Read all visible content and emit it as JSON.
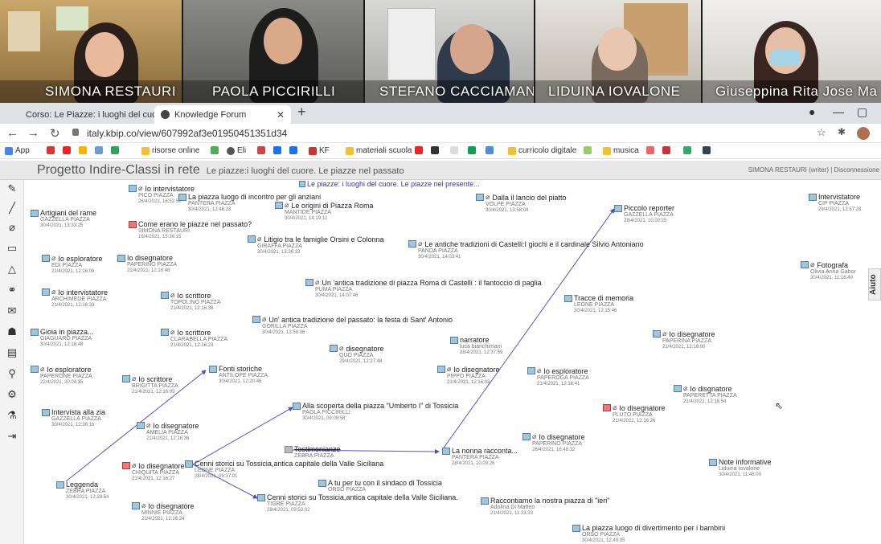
{
  "participants": [
    {
      "name": "SIMONA RESTAURI"
    },
    {
      "name": "PAOLA PICCIRILLI"
    },
    {
      "name": "STEFANO CACCIAMANI"
    },
    {
      "name": "LIDUINA IOVALONE"
    },
    {
      "name": "Giuseppina Rita Jose Ma"
    }
  ],
  "browser": {
    "tabs": [
      {
        "label": "Corso: Le Piazze: i luoghi del cuo"
      },
      {
        "label": "Knowledge Forum"
      }
    ],
    "new_tab": "+",
    "url": "italy.kbip.co/view/607992af3e01950451351d34",
    "bookmarks": [
      "App",
      "risorse online",
      "Eli",
      "KF",
      "materiali scuola",
      "curricolo digitale",
      "musica"
    ]
  },
  "kf": {
    "project": "Progetto Indire-Classi in rete",
    "view": "Le piazze:i luoghi del cuore. Le piazze nel passato",
    "user": "SIMONA RESTAURI (writer) | Disconnessione",
    "help": "Aiuto",
    "link_note": "Le piazze: i luoghi del cuore. Le piazze nel presente..."
  },
  "notes": [
    {
      "title": "Io intervistatore",
      "author": "PICO PIAZZA",
      "date": "26/4/2021, 16:52:50"
    },
    {
      "title": "La piazza luogo di incontro per gli anziani",
      "author": "PANTERA PIAZZA",
      "date": "30/4/2021, 12:46:23"
    },
    {
      "title": "Artigiani del rame",
      "author": "GAZZELLA PIAZZA",
      "date": "30/4/2021, 13:33:25"
    },
    {
      "title": "Le origini di Piazza Roma",
      "author": "MANTIDE PIAZZA",
      "date": "30/4/2021, 14:19:12"
    },
    {
      "title": "Dalla il lancio del piatto",
      "author": "VOLPE PIAZZA",
      "date": "30/4/2021, 13:58:04"
    },
    {
      "title": "Piccolo reporter",
      "author": "GAZZELLA PIAZZA",
      "date": "28/4/2021, 10:00:25"
    },
    {
      "title": "Intervistatore",
      "author": "CIP PIAZZA",
      "date": "29/4/2021, 12:57:23"
    },
    {
      "title": "Come erano le piazze nel passato?",
      "author": "SIMONA RESTAURI",
      "date": "16/4/2021, 15:36:15"
    },
    {
      "title": "Litigio tra le famiglie Orsini e Colonna",
      "author": "GIRAFFA PIAZZA",
      "date": "30/4/2021, 13:36:33"
    },
    {
      "title": "Le antiche tradizioni di Castelli:I giochi e il cardinale Silvio Antoniano",
      "author": "PANDA PIAZZA",
      "date": "30/4/2021, 14:03:41"
    },
    {
      "title": "Io esploratore",
      "author": "EDI PIAZZA",
      "date": "21/4/2021, 12:16:06"
    },
    {
      "title": "Io disegnatore",
      "author": "PAPERINO PIAZZA",
      "date": "21/4/2021, 12:16:48"
    },
    {
      "title": "Fotografa",
      "author": "Olivia Anna Gabor",
      "date": "30/4/2021, 11:16:49"
    },
    {
      "title": "Un 'antica tradizione di piazza Roma di Castelli : il fantoccio di paglia",
      "author": "PUMA PIAZZA",
      "date": "30/4/2021, 14:07:46"
    },
    {
      "title": "Io intervistatore",
      "author": "ARCHIMEDE PIAZZA",
      "date": "21/4/2021, 12:16:33"
    },
    {
      "title": "Io scrittore",
      "author": "TOPOLINO PIAZZA",
      "date": "21/4/2021, 12:16:38"
    },
    {
      "title": "Tracce di memoria",
      "author": "LEONE PIAZZA",
      "date": "30/4/2021, 12:15:46"
    },
    {
      "title": "Un' antica tradizione del passato: la festa di Sant' Antonio",
      "author": "GORILLA PIAZZA",
      "date": "30/4/2021, 13:58:06"
    },
    {
      "title": "Gioia in piazza...",
      "author": "GIAGUARO PIAZZA",
      "date": "30/4/2021, 12:18:48"
    },
    {
      "title": "Io scrittore",
      "author": "CLARABELLA PIAZZA",
      "date": "21/4/2021, 12:16:23"
    },
    {
      "title": "Io disegnatore",
      "author": "PAPERINA PIAZZA",
      "date": "21/4/2021, 12:16:00"
    },
    {
      "title": "narratore",
      "author": "luca bianchimani",
      "date": "28/4/2021, 12:37:59"
    },
    {
      "title": "disegnatore",
      "author": "QUO PIAZZA",
      "date": "29/4/2021, 12:27:48"
    },
    {
      "title": "Io esploratore",
      "author": "PAPERONE PIAZZA",
      "date": "22/4/2021, 20:04:35"
    },
    {
      "title": "Fonti storiche",
      "author": "ANTILOPE PIAZZA",
      "date": "30/4/2021, 12:20:46"
    },
    {
      "title": "Io disegnatore",
      "author": "PIPPO PIAZZA",
      "date": "21/4/2021, 12:16:03"
    },
    {
      "title": "Io esploratore",
      "author": "PAPEROGA PIAZZA",
      "date": "21/4/2021, 12:16:41"
    },
    {
      "title": "Io scrittore",
      "author": "BRIGITTA PIAZZA",
      "date": "21/4/2021, 12:16:05"
    },
    {
      "title": "Io disgnatore",
      "author": "PAPERETTA PIAZZA",
      "date": "21/4/2021, 12:16:54"
    },
    {
      "title": "Io disegnatore",
      "author": "PLUTO PIAZZA",
      "date": "21/4/2021, 12:16:26"
    },
    {
      "title": "Intervista alla zia",
      "author": "GAZZELLA PIAZZA",
      "date": "30/4/2021, 12:36:16"
    },
    {
      "title": "Alla scoperta della piazza \"Umberto I\" di Tossicia",
      "author": "PAOLA PICCIRILLI",
      "date": "30/4/2021, 09:09:58"
    },
    {
      "title": "Io disegnatore",
      "author": "AMELIA PIAZZA",
      "date": "21/4/2021, 12:16:36"
    },
    {
      "title": "Io disegnatore",
      "author": "PAPERINO PIAZZA",
      "date": "26/4/2021, 16:48:32"
    },
    {
      "title": "Testimonianze",
      "author": "ZEBRA PIAZZA",
      "date": ""
    },
    {
      "title": "La nonna racconta...",
      "author": "PANTERA PIAZZA",
      "date": "28/4/2021, 10:09:26"
    },
    {
      "title": "Io disegnatore",
      "author": "CHIQUITA PIAZZA",
      "date": "21/4/2021, 12:16:27"
    },
    {
      "title": "Cenni storici su Tossicia,antica capitale della Valle Siciliana",
      "author": "LEONE PIAZZA",
      "date": "28/4/2021, 09:37:01"
    },
    {
      "title": "Note informative",
      "author": "Liduina Iovalone",
      "date": "30/4/2021, 11:48:00"
    },
    {
      "title": "Leggenda",
      "author": "ZEBRA PIAZZA",
      "date": "30/4/2021, 12:28:54"
    },
    {
      "title": "A tu per tu con il sindaco di Tossicia",
      "author": "ORSO PIAZZA",
      "date": ""
    },
    {
      "title": "Cenni storici su Tossicia,antica capitale della Valle Siciliana.",
      "author": "TIGRE PIAZZA",
      "date": "28/4/2021, 09:53:02"
    },
    {
      "title": "Raccontiamo la nostra piazza di \"ieri\"",
      "author": "Adolina Di Matteo",
      "date": "21/4/2021, 11:23:33"
    },
    {
      "title": "Io disegnatore",
      "author": "MINNIE PIAZZA",
      "date": "21/4/2021, 12:16:24"
    },
    {
      "title": "La piazza luogo di divertimento per i bambini",
      "author": "ORSO PIAZZA",
      "date": "30/4/2021, 12:49:05"
    }
  ]
}
